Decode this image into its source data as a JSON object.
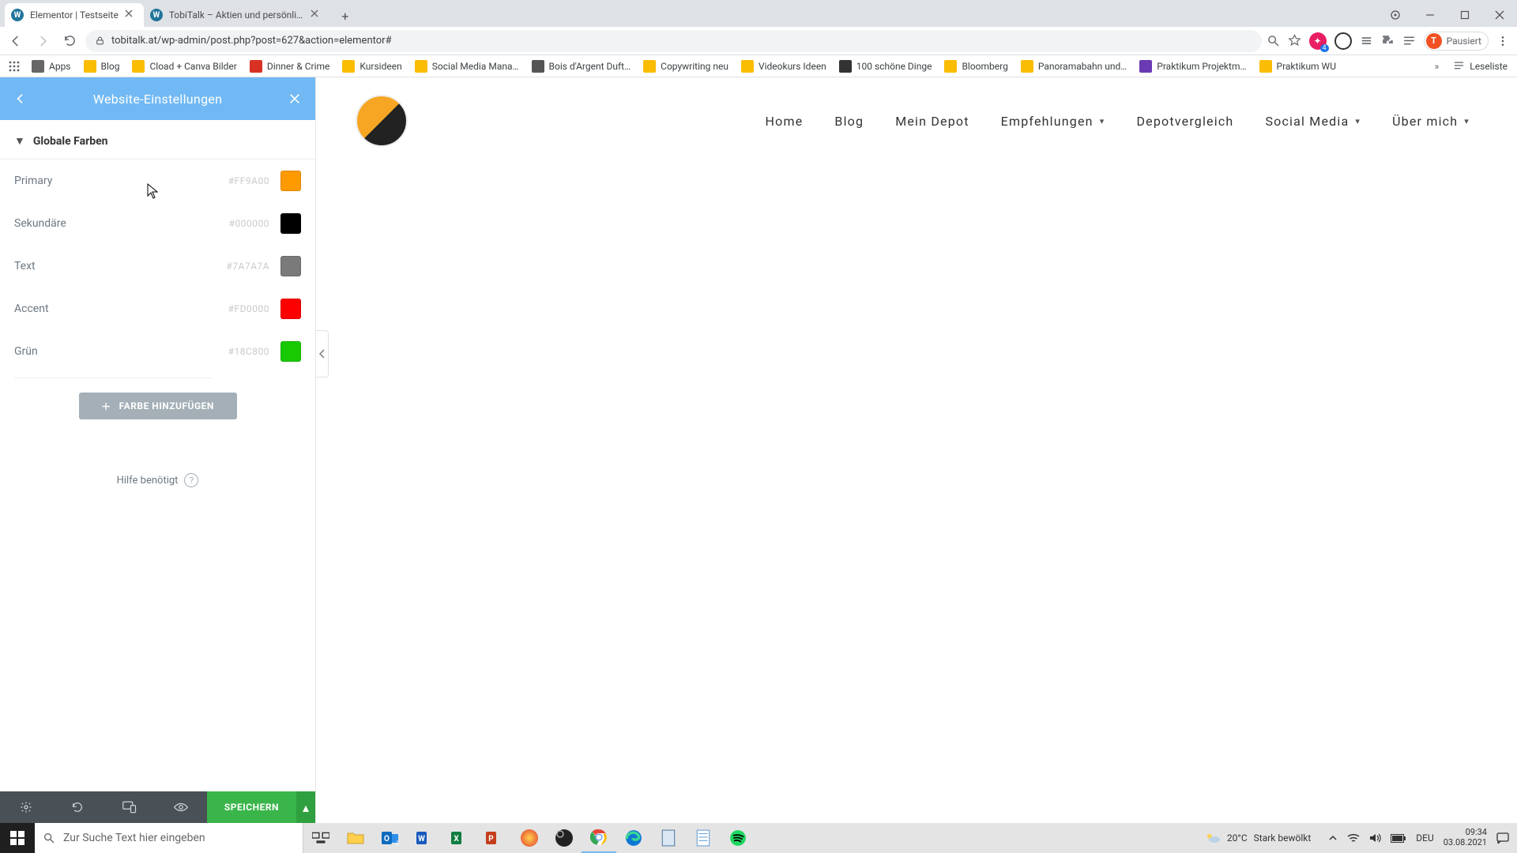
{
  "browser": {
    "tabs": [
      {
        "title": "Elementor | Testseite",
        "active": true
      },
      {
        "title": "TobiTalk – Aktien und persönliche…",
        "active": false
      }
    ],
    "url": "tobitalk.at/wp-admin/post.php?post=627&action=elementor#",
    "profile_label": "Pausiert",
    "profile_initial": "T",
    "bookmarks": [
      "Apps",
      "Blog",
      "Cload + Canva Bilder",
      "Dinner & Crime",
      "Kursideen",
      "Social Media Mana…",
      "Bois d'Argent Duft…",
      "Copywriting neu",
      "Videokurs Ideen",
      "100 schöne Dinge",
      "Bloomberg",
      "Panoramabahn und…",
      "Praktikum Projektm…",
      "Praktikum WU"
    ],
    "reading_list": "Leseliste"
  },
  "panel": {
    "title": "Website-Einstellungen",
    "section": "Globale Farben",
    "colors": [
      {
        "name": "Primary",
        "hex": "#FF9A00",
        "swatch": "#FF9A00"
      },
      {
        "name": "Sekundäre",
        "hex": "#000000",
        "swatch": "#000000"
      },
      {
        "name": "Text",
        "hex": "#7A7A7A",
        "swatch": "#7A7A7A"
      },
      {
        "name": "Accent",
        "hex": "#FD0000",
        "swatch": "#FD0000"
      },
      {
        "name": "Grün",
        "hex": "#18C800",
        "swatch": "#18C800"
      }
    ],
    "add_label": "FARBE HINZUFÜGEN",
    "help": "Hilfe benötigt",
    "save": "SPEICHERN"
  },
  "site_menu": [
    {
      "label": "Home",
      "dropdown": false
    },
    {
      "label": "Blog",
      "dropdown": false
    },
    {
      "label": "Mein Depot",
      "dropdown": false
    },
    {
      "label": "Empfehlungen",
      "dropdown": true
    },
    {
      "label": "Depotvergleich",
      "dropdown": false
    },
    {
      "label": "Social Media",
      "dropdown": true
    },
    {
      "label": "Über mich",
      "dropdown": true
    }
  ],
  "taskbar": {
    "search_placeholder": "Zur Suche Text hier eingeben",
    "weather_temp": "20°C",
    "weather_desc": "Stark bewölkt",
    "lang": "DEU",
    "time": "09:34",
    "date": "03.08.2021"
  }
}
